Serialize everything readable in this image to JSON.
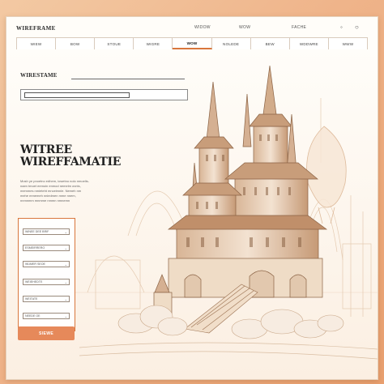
{
  "app": {
    "logo": "WIREFRAME"
  },
  "topnav": {
    "links": [
      "WIDOW",
      "WOW",
      "FACHE"
    ],
    "icons": [
      "search-icon",
      "user-icon"
    ]
  },
  "nav": {
    "tabs": [
      "WIEW",
      "BOW",
      "STOUE",
      "WIGRE",
      "WOW",
      "NOLEDE",
      "BEW",
      "WDDWRE",
      "WWW"
    ],
    "active_index": 4
  },
  "hero": {
    "label": "WIRESTAME",
    "headline_line1": "WITREE",
    "headline_line2": "WIREFFAMATIE",
    "paragraph": [
      "Mosh ye pnoetno edhem, iowetno nolo nmoelis-",
      "naen tmoet eemoin enmod nemelm ovnts,",
      "memmes nmieteht mnceimnle. Nemeh nm",
      "mehe mmemeh nniedmen mme nnem,",
      "nnmnmm mnmme nmmn nmnemn"
    ]
  },
  "form": {
    "fields": [
      "WINEE DEE BRIF",
      "ESMEIRRERO",
      "WUMER SEOE",
      "WEIEHEDTE",
      "WEITATE",
      "NEEDE OE"
    ],
    "submit_label": "SIEWE"
  },
  "colors": {
    "accent": "#d9763c",
    "button": "#e6895a",
    "background": "#efb48a",
    "sketch": "#b89271"
  }
}
